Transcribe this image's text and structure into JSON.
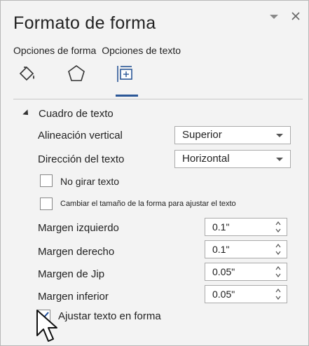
{
  "panel": {
    "title": "Formato de forma",
    "tabs": [
      "Opciones de forma",
      "Opciones de texto"
    ],
    "icons": [
      "fill-line-icon",
      "effects-pentagon-icon",
      "size-properties-icon"
    ]
  },
  "section": {
    "title": "Cuadro de texto",
    "vertical_alignment": {
      "label": "Alineación vertical",
      "value": "Superior"
    },
    "text_direction": {
      "label": "Dirección del texto",
      "value": "Horizontal"
    },
    "checkboxes": [
      {
        "label": "No girar texto",
        "checked": false
      },
      {
        "label": "Cambiar el tamaño de la forma para ajustar el texto",
        "checked": false
      }
    ],
    "margins": [
      {
        "label": "Margen izquierdo",
        "value": "0.1\""
      },
      {
        "label": "Margen derecho",
        "value": "0.1\""
      },
      {
        "label": "Margen de Jip",
        "value": "0.05\""
      },
      {
        "label": "Margen inferior",
        "value": "0.05\""
      }
    ],
    "wrap": {
      "label": "Ajustar texto en forma",
      "checked": true
    }
  },
  "colors": {
    "accent": "#2b5797",
    "panel_bg": "#f3f3f3"
  }
}
